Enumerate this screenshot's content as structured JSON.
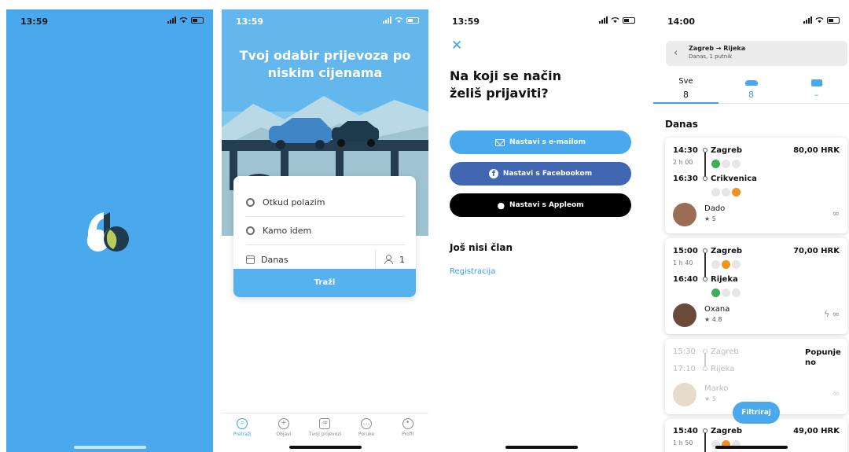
{
  "colors": {
    "brand_blue": "#4aa8ec",
    "facebook_blue": "#4267b2",
    "apple_black": "#000000",
    "green": "#3fae5a",
    "orange": "#f0921e"
  },
  "screen1": {
    "time": "13:59",
    "logo_icon": "blablacar-logo"
  },
  "screen2": {
    "time": "13:59",
    "hero_title": "Tvoj odabir prijevoza po niskim cijenama",
    "from_placeholder": "Otkud polazim",
    "to_placeholder": "Kamo idem",
    "date_value": "Danas",
    "passengers": "1",
    "search_label": "Traži",
    "tabs": [
      {
        "label": "Pretraži",
        "icon": "search-icon"
      },
      {
        "label": "Objavi",
        "icon": "plus-circle-icon"
      },
      {
        "label": "Tvoji prijevozi",
        "icon": "rides-icon"
      },
      {
        "label": "Poruke",
        "icon": "messages-icon"
      },
      {
        "label": "Profil",
        "icon": "profile-icon"
      }
    ]
  },
  "screen3": {
    "time": "13:59",
    "close_icon": "close-icon",
    "heading_line1": "Na koji se način",
    "heading_line2": "želiš prijaviti?",
    "email_label": "Nastavi s e-mailom",
    "facebook_label": "Nastavi s Facebookom",
    "apple_label": "Nastavi s Appleom",
    "no_member": "Još nisi član",
    "register": "Registracija"
  },
  "screen4": {
    "time": "14:00",
    "route": "Zagreb → Rijeka",
    "route_sub": "Danas, 1 putnik",
    "filter_tabs": [
      {
        "label": "Sve",
        "count": "8"
      },
      {
        "label": "",
        "icon": "car-icon",
        "count": "8"
      },
      {
        "label": "",
        "icon": "bus-icon",
        "count": "–"
      }
    ],
    "day": "Danas",
    "rides": [
      {
        "dep_time": "14:30",
        "duration": "2 h 00",
        "arr_time": "16:30",
        "from": "Zagreb",
        "to": "Crikvenica",
        "price": "80,00 HRK",
        "driver": "Dado",
        "rating": "5"
      },
      {
        "dep_time": "15:00",
        "duration": "1 h 40",
        "arr_time": "16:40",
        "from": "Zagreb",
        "to": "Rijeka",
        "price": "70,00 HRK",
        "driver": "Oxana",
        "rating": "4.8"
      },
      {
        "dep_time": "15:30",
        "arr_time": "17:10",
        "from": "Zagreb",
        "to": "Rijeka",
        "price_line1": "Popunje",
        "price_line2": "no",
        "driver": "Marko",
        "rating": "5"
      },
      {
        "dep_time": "15:40",
        "duration": "1 h 50",
        "from": "Zagreb",
        "price": "49,00 HRK"
      }
    ],
    "filter_label": "Filtriraj"
  }
}
